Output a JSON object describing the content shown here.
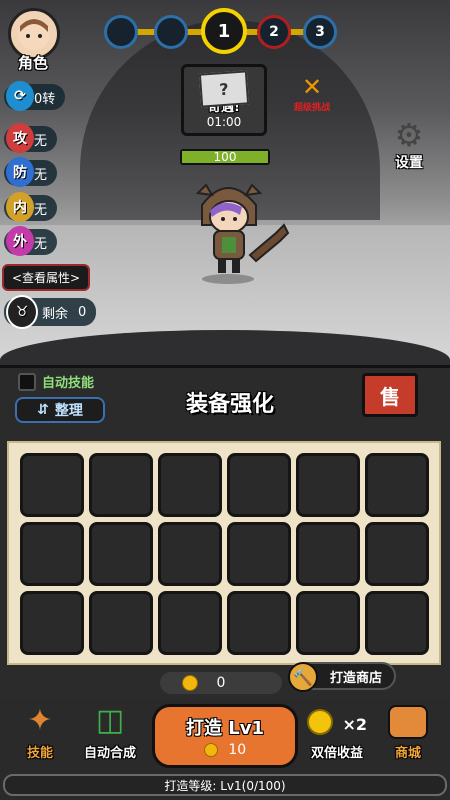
{
  "player": {
    "avatar_label": "角色",
    "rebirth": "0转"
  },
  "stages": [
    {
      "number": ""
    },
    {
      "number": ""
    },
    {
      "number": "1"
    },
    {
      "number": "2"
    },
    {
      "number": "3"
    }
  ],
  "stats": [
    {
      "badge": "攻",
      "value": "无",
      "color": "#d13c3c"
    },
    {
      "badge": "防",
      "value": "无",
      "color": "#2f6fd1"
    },
    {
      "badge": "内",
      "value": "无",
      "color": "#d2a12a"
    },
    {
      "badge": "外",
      "value": "无",
      "color": "#c43aa8"
    }
  ],
  "view_attributes": "<查看属性>",
  "remaining": {
    "label": "剩余",
    "value": "0"
  },
  "encounter": {
    "title": "奇遇!",
    "time": "01:00"
  },
  "challenge": {
    "label": "超级挑战"
  },
  "settings": {
    "label": "设置"
  },
  "hp": {
    "value": "100",
    "fill": 1.0
  },
  "panel": {
    "auto_skill": "自动技能",
    "sort": "整理",
    "title": "装备强化",
    "sell": "售"
  },
  "gold": {
    "value": "0"
  },
  "forge_shop": "打造商店",
  "bottom": {
    "skill": "技能",
    "auto_merge": "自动合成",
    "forge_label": "打造 Lv1",
    "forge_cost": "10",
    "double": "双倍收益",
    "mall": "商城",
    "x2": "×2"
  },
  "forge_level": "打造等级: Lv1(0/100)",
  "colors": {
    "accent": "#e8752f",
    "hp": "#7fb02a",
    "gold": "#f2b70c"
  }
}
